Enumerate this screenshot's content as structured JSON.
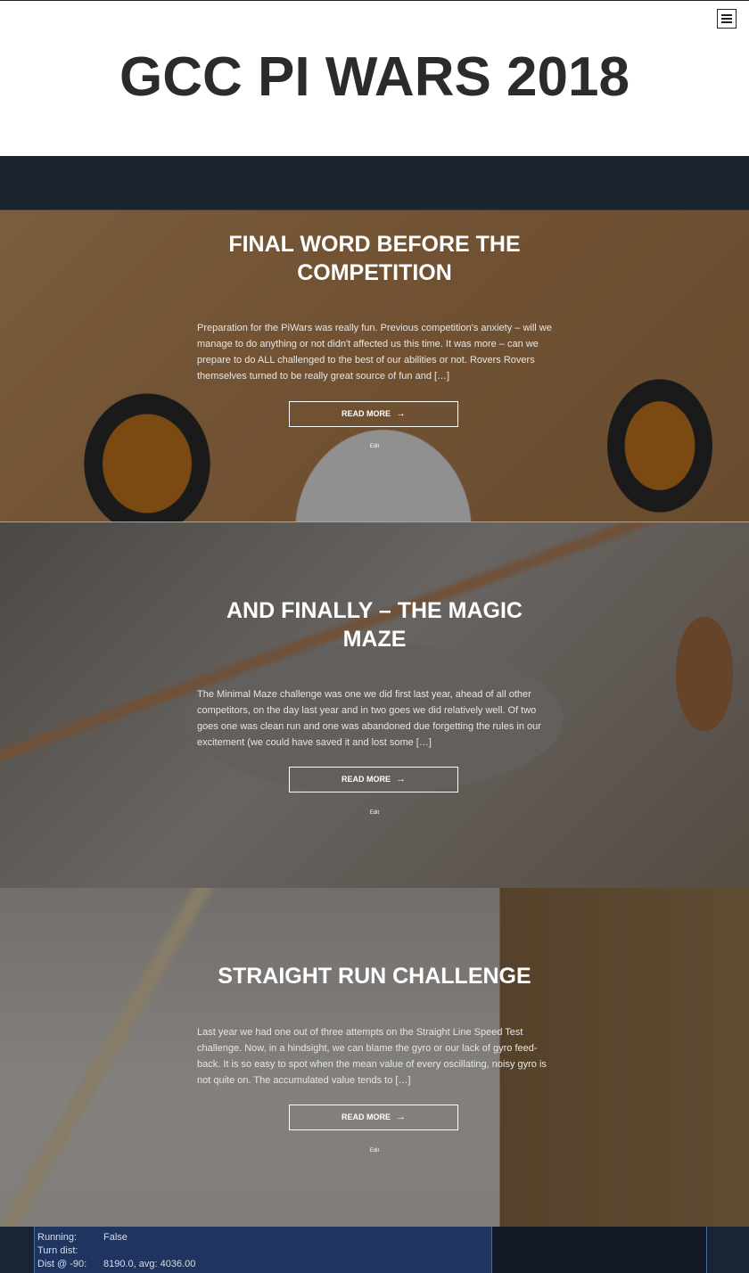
{
  "site": {
    "title": "GCC PI WARS 2018"
  },
  "posts": [
    {
      "title": "FINAL WORD BEFORE THE COMPETITION",
      "excerpt": "Preparation for the PiWars was really fun. Previous competition's anxiety – will we manage to do anything or not didn't affected us this time. It was more – can we prepare to do ALL challenged to the best of our abilities or not. Rovers Rovers themselves turned to be really great source of fun and […]",
      "read_more": "READ MORE",
      "edit": "Edit"
    },
    {
      "title": "AND FINALLY – THE MAGIC MAZE",
      "excerpt": "The Minimal Maze challenge was one we did first last year, ahead of all other competitors, on the day last year and in two goes we did relatively well. Of two goes one was clean run and one was abandoned due forgetting the rules in our excitement (we could have saved it and lost some […]",
      "read_more": "READ MORE",
      "edit": "Edit"
    },
    {
      "title": "STRAIGHT RUN CHALLENGE",
      "excerpt": "Last year we had one out of three attempts on the Straight Line Speed Test challenge. Now, in a hindsight, we can blame the gyro or our lack of gyro feed-back. It is so easy to spot when the mean value of every oscillating, noisy gyro is not quite on. The accumulated value tends to […]",
      "read_more": "READ MORE",
      "edit": "Edit"
    }
  ],
  "terminal": {
    "rows": [
      {
        "key": "Running:",
        "value": "False"
      },
      {
        "key": "Turn dist:",
        "value": ""
      },
      {
        "key": "Dist @ -90:",
        "value": "8190.0, avg: 4036.00"
      }
    ]
  },
  "icons": {
    "menu": "hamburger-icon",
    "arrow": "arrow-right-icon"
  }
}
